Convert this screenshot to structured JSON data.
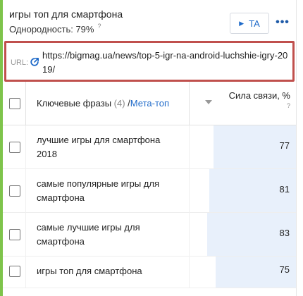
{
  "header": {
    "title": "игры топ для смартфона",
    "homogeneity_label": "Однородность: 79%",
    "help_mark": "?"
  },
  "actions": {
    "ta_label": "TA",
    "ta_icon": "play-icon",
    "more_icon": "more-dots-icon"
  },
  "url": {
    "label": "URL:",
    "icon": "external-link-icon",
    "value": "https://bigmag.ua/news/top-5-igr-na-android-luchshie-igry-2019/"
  },
  "table": {
    "col_phrases": "Ключевые фразы",
    "phrase_count": "(4)",
    "separator": "/",
    "meta_top": "Мета-топ",
    "col_strength": "Сила связи, %",
    "strength_help": "?",
    "sort_icon": "sort-desc-icon",
    "rows": [
      {
        "phrase": "лучшие игры для смартфона 2018",
        "value": "77",
        "fraction": 0.77
      },
      {
        "phrase": "самые популярные игры для смартфона",
        "value": "81",
        "fraction": 0.81
      },
      {
        "phrase": "самые лучшие игры для смартфона",
        "value": "83",
        "fraction": 0.83
      },
      {
        "phrase": "игры топ для смартфона",
        "value": "75",
        "fraction": 0.75
      }
    ]
  },
  "colors": {
    "accent_green": "#7ec44b",
    "link_blue": "#1e6ac9",
    "highlight_red": "#c0504d",
    "bar_fill": "#e8f0fb"
  }
}
